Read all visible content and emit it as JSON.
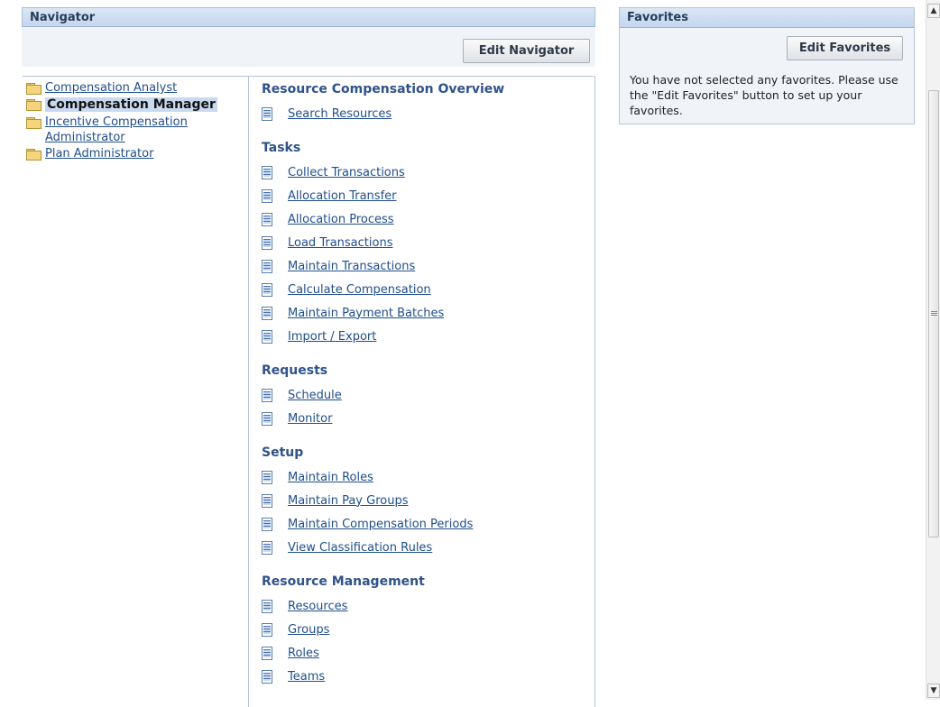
{
  "navigator": {
    "title": "Navigator",
    "edit_button": "Edit Navigator",
    "tree": [
      {
        "label": "Compensation Analyst",
        "selected": false
      },
      {
        "label": "Compensation Manager",
        "selected": true
      },
      {
        "label": "Incentive Compensation Administrator",
        "selected": false
      },
      {
        "label": "Plan Administrator",
        "selected": false
      }
    ],
    "sections": [
      {
        "title": "Resource Compensation Overview",
        "links": [
          "Search Resources"
        ]
      },
      {
        "title": "Tasks",
        "links": [
          "Collect Transactions",
          "Allocation Transfer",
          "Allocation Process",
          "Load Transactions",
          "Maintain Transactions",
          "Calculate Compensation",
          "Maintain Payment Batches",
          "Import / Export"
        ]
      },
      {
        "title": "Requests",
        "links": [
          "Schedule",
          "Monitor"
        ]
      },
      {
        "title": "Setup",
        "links": [
          "Maintain Roles",
          "Maintain Pay Groups",
          "Maintain Compensation Periods",
          "View Classification Rules"
        ]
      },
      {
        "title": "Resource Management",
        "links": [
          "Resources",
          "Groups",
          "Roles",
          "Teams"
        ]
      }
    ]
  },
  "favorites": {
    "title": "Favorites",
    "edit_button": "Edit Favorites",
    "message": "You have not selected any favorites. Please use the \"Edit Favorites\" button to set up your favorites."
  },
  "icons": {
    "folder": "folder-icon",
    "document": "document-icon",
    "scroll_up": "arrow-up-icon",
    "scroll_down": "arrow-down-icon"
  },
  "colors": {
    "header_bg": "#c4d6ed",
    "link": "#1f4e8c",
    "section_title": "#2f5289",
    "selected_bg": "#c9d9ef"
  }
}
